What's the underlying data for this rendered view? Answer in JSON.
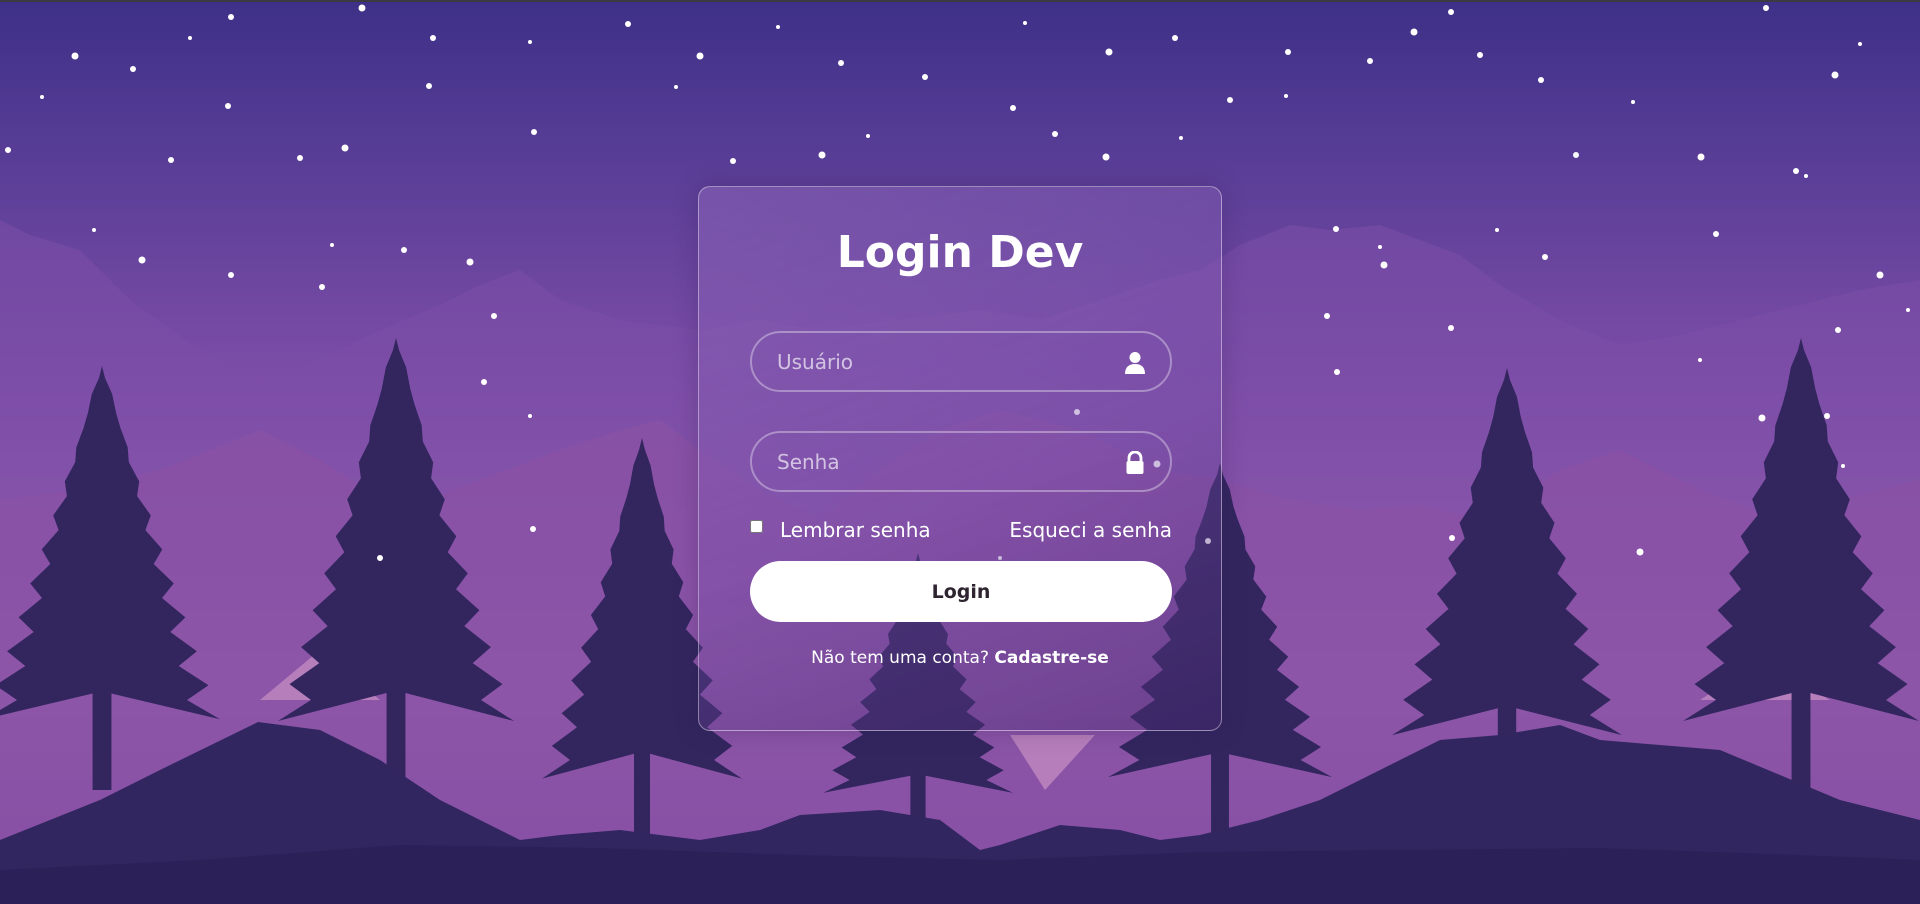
{
  "login": {
    "title": "Login Dev",
    "username_placeholder": "Usuário",
    "password_placeholder": "Senha",
    "remember_label": "Lembrar senha",
    "remember_checked": false,
    "forgot_link": "Esqueci a senha",
    "login_button": "Login",
    "register_prompt": "Não tem uma conta?",
    "register_link": "Cadastre-se"
  },
  "icons": {
    "username": "user-icon",
    "password": "lock-icon"
  },
  "colors": {
    "sky_top": "#3e3088",
    "sky_mid": "#7a4ca6",
    "horizon_glow": "#b47bb6",
    "tree_silhouette": "#33265f",
    "hill_dark": "#312660",
    "button_background": "#ffffff",
    "text": "#ffffff"
  }
}
